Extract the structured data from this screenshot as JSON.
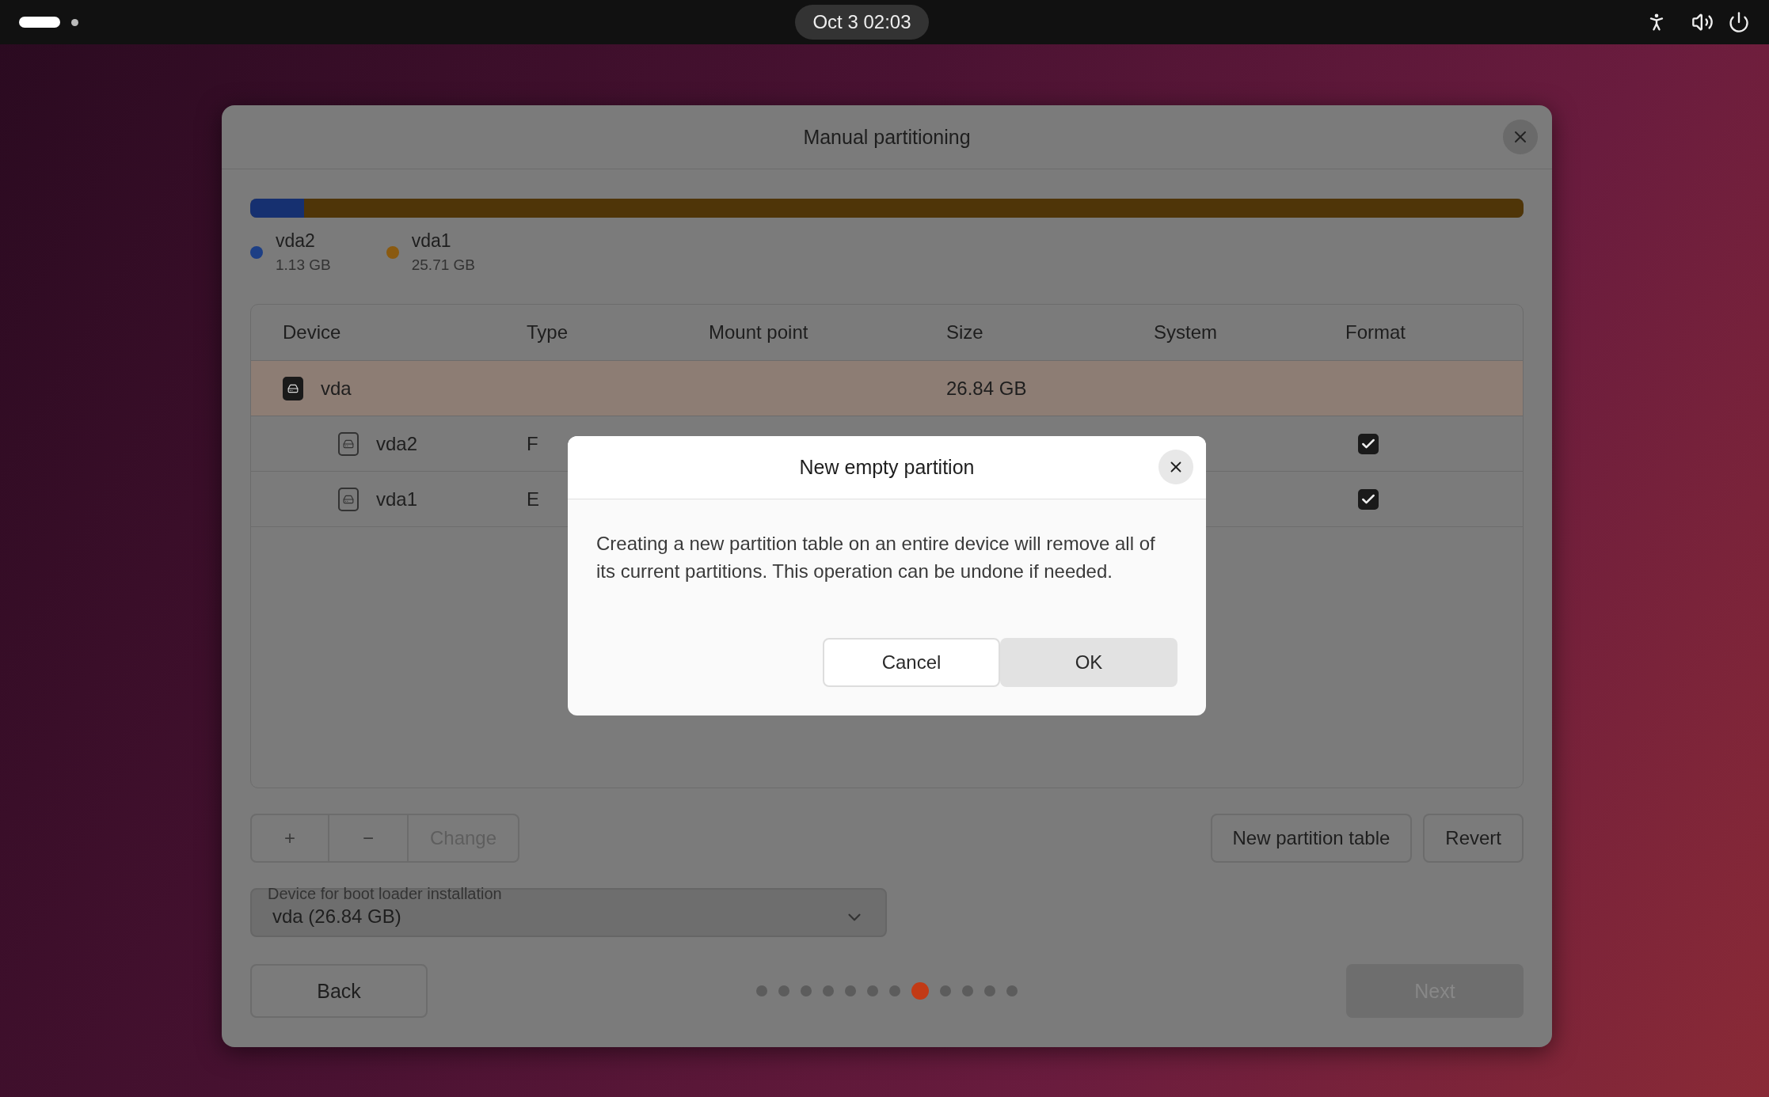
{
  "top_bar": {
    "clock": "Oct 3  02:03"
  },
  "window": {
    "title": "Manual partitioning"
  },
  "disk_bar": {
    "segments": [
      {
        "color": "#163070",
        "level": 0.042
      },
      {
        "color": "#4f3508",
        "level": 0.958
      }
    ]
  },
  "legend": [
    {
      "name": "vda2",
      "size": "1.13 GB",
      "color": "#1d3f85"
    },
    {
      "name": "vda1",
      "size": "25.71 GB",
      "color": "#8a5a10"
    }
  ],
  "table": {
    "columns": [
      "Device",
      "Type",
      "Mount point",
      "Size",
      "System",
      "Format"
    ],
    "rows": [
      {
        "kind": "disk",
        "device": "vda",
        "type": "",
        "size": "26.84 GB",
        "selected": true
      },
      {
        "kind": "partition",
        "device": "vda2",
        "type": "F",
        "size": "",
        "selected": false,
        "format": true
      },
      {
        "kind": "partition",
        "device": "vda1",
        "type": "E",
        "size": "",
        "selected": false,
        "format": true
      }
    ]
  },
  "edit_buttons": [
    {
      "label": "+",
      "disabled": false
    },
    {
      "label": "−",
      "disabled": false
    },
    {
      "label": "Change",
      "disabled": true
    }
  ],
  "table_buttons": [
    "New partition table",
    "Revert"
  ],
  "boot_loader": {
    "label": "Device for boot loader installation",
    "value": "vda  (26.84 GB)"
  },
  "navigation": {
    "back": "Back",
    "next": "Next",
    "next_disabled": true,
    "steps": [
      {
        "selected": false
      },
      {
        "selected": false
      },
      {
        "selected": false
      },
      {
        "selected": false
      },
      {
        "selected": false
      },
      {
        "selected": false
      },
      {
        "selected": false
      },
      {
        "selected": true
      },
      {
        "selected": false
      },
      {
        "selected": false
      },
      {
        "selected": false
      },
      {
        "selected": false
      }
    ]
  },
  "dialog": {
    "title": "New empty partition",
    "message": "Creating a new partition table on an entire device will remove all of its current partitions. This operation can be undone if needed.",
    "buttons": [
      "Cancel",
      "OK"
    ]
  }
}
